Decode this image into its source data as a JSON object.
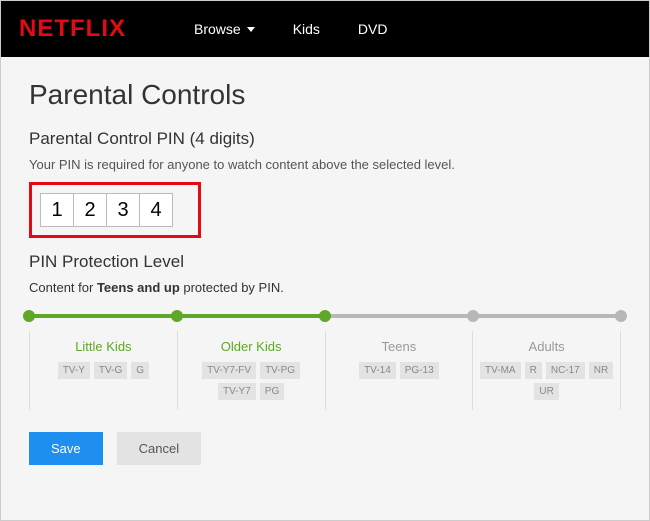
{
  "logo": "NETFLIX",
  "nav": {
    "browse": "Browse",
    "kids": "Kids",
    "dvd": "DVD"
  },
  "title": "Parental Controls",
  "pin_section": {
    "heading": "Parental Control PIN (4 digits)",
    "subtext": "Your PIN is required for anyone to watch content above the selected level.",
    "digits": [
      "1",
      "2",
      "3",
      "4"
    ]
  },
  "level_section": {
    "heading": "PIN Protection Level",
    "desc_prefix": "Content for ",
    "desc_bold": "Teens and up",
    "desc_suffix": " protected by PIN.",
    "selected_index": 2,
    "levels": [
      {
        "name": "Little Kids",
        "active": true,
        "tags": [
          "TV-Y",
          "TV-G",
          "G"
        ]
      },
      {
        "name": "Older Kids",
        "active": true,
        "tags": [
          "TV-Y7-FV",
          "TV-PG",
          "TV-Y7",
          "PG"
        ]
      },
      {
        "name": "Teens",
        "active": false,
        "tags": [
          "TV-14",
          "PG-13"
        ]
      },
      {
        "name": "Adults",
        "active": false,
        "tags": [
          "TV-MA",
          "R",
          "NC-17",
          "NR",
          "UR"
        ]
      }
    ]
  },
  "actions": {
    "save": "Save",
    "cancel": "Cancel"
  }
}
